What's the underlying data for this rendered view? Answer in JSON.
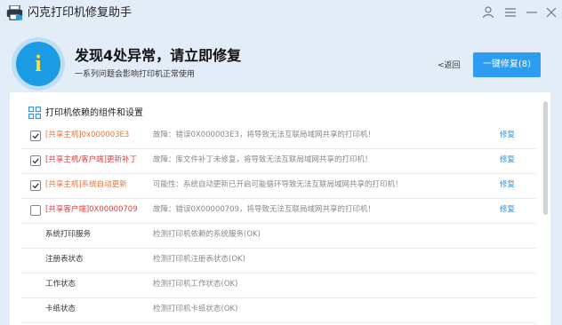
{
  "window": {
    "title": "闪克打印机修复助手",
    "controls": [
      "user-icon",
      "menu-icon",
      "minimize-icon",
      "close-icon"
    ]
  },
  "hero": {
    "icon_glyph": "i",
    "title": "发现4处异常，请立即修复",
    "subtitle": "一系列问题会影响打印机正常使用",
    "back_label": "<返回",
    "fix_all_label": "一键修复(8)"
  },
  "section": {
    "title": "打印机依赖的组件和设置"
  },
  "issues": [
    {
      "checked": true,
      "name": "[共享主机]0x000003E3",
      "desc": "故障：错误0X000003E3，将导致无法互联局域网共享的打印机！",
      "action": "修复",
      "color": "#e87434"
    },
    {
      "checked": true,
      "name": "[共享主机/客户端]更新补丁",
      "desc": "故障：库文件补丁未修复，将导致无法互联局域网共享的打印机！",
      "action": "修复",
      "color": "#e23b3b"
    },
    {
      "checked": true,
      "name": "[共享主机]系统自动更新",
      "desc": "可能性：系统自动更新已开启可能循环导致无法互联局域网共享的打印机！",
      "action": "修复",
      "color": "#e87434"
    },
    {
      "checked": false,
      "name": "[共享客户端]0X00000709",
      "desc": "故障：错误0X00000709，将导致无法互联局域网共享的打印机！",
      "action": "修复",
      "color": "#e23b3b"
    }
  ],
  "checks": [
    {
      "name": "系统打印服务",
      "desc": "检测打印机依赖的系统服务(OK)"
    },
    {
      "name": "注册表状态",
      "desc": "检测打印机注册表状态(OK)"
    },
    {
      "name": "工作状态",
      "desc": "检测打印机工作状态(OK)"
    },
    {
      "name": "卡纸状态",
      "desc": "检测打印机卡纸状态(OK)"
    }
  ]
}
